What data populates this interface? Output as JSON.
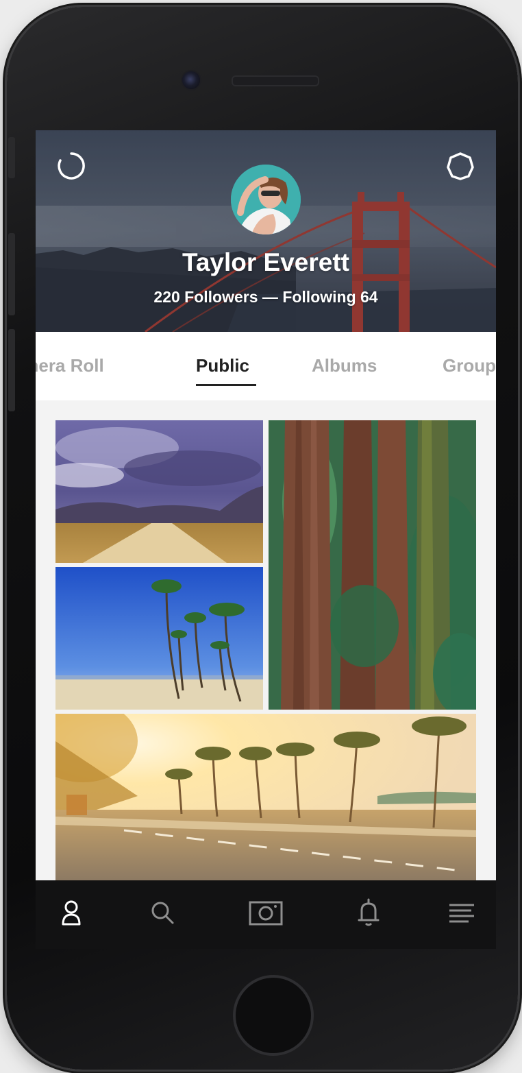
{
  "profile": {
    "name": "Taylor Everett",
    "followers": "220 Followers",
    "separator": " — ",
    "following": "Following 64"
  },
  "header": {
    "left_icon": "refresh-icon",
    "right_icon": "settings-gear-icon"
  },
  "tabs": [
    {
      "label": "Camera Roll",
      "active": false
    },
    {
      "label": "Public",
      "active": true
    },
    {
      "label": "Albums",
      "active": false
    },
    {
      "label": "Groups",
      "active": false
    }
  ],
  "photos": [
    {
      "name": "photo-desert-road",
      "subject": "desert road under stormy sky"
    },
    {
      "name": "photo-redwood-forest",
      "subject": "redwood tree trunks"
    },
    {
      "name": "photo-beach-palms",
      "subject": "palm trees on beach"
    },
    {
      "name": "photo-palm-boulevard",
      "subject": "palm lined road at sunset"
    }
  ],
  "bottom_nav": [
    {
      "icon": "profile-icon",
      "active": true
    },
    {
      "icon": "search-icon",
      "active": false
    },
    {
      "icon": "camera-icon",
      "active": false
    },
    {
      "icon": "notifications-bell-icon",
      "active": false
    },
    {
      "icon": "menu-icon",
      "active": false
    }
  ],
  "colors": {
    "active_tab": "#222222",
    "inactive_tab": "#a9a9a9",
    "nav_bg": "#121213",
    "bridge": "#b23a2c"
  }
}
